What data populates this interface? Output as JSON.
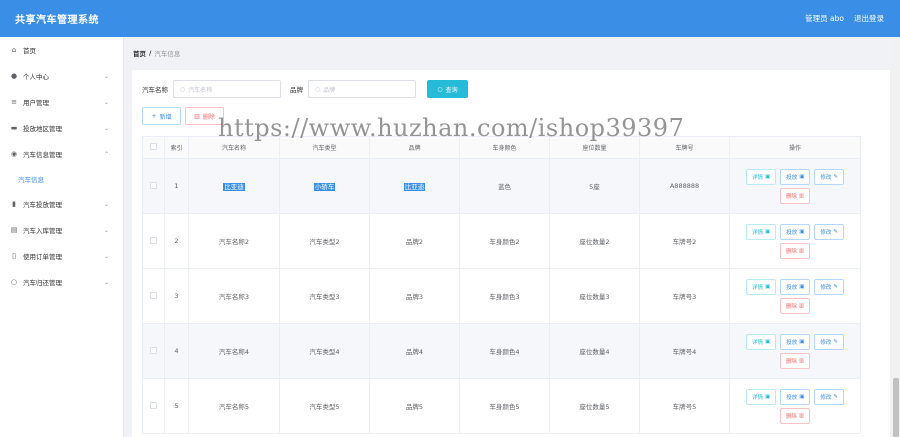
{
  "app": {
    "title": "共享汽车管理系统",
    "user": "管理员 abo",
    "logout": "退出登录"
  },
  "sidebar": {
    "items": [
      {
        "label": "首页",
        "icon": "home-icon",
        "expandable": false
      },
      {
        "label": "个人中心",
        "icon": "user-icon",
        "expandable": true
      },
      {
        "label": "用户管理",
        "icon": "list-icon",
        "expandable": true
      },
      {
        "label": "投放地区管理",
        "icon": "monitor-icon",
        "expandable": true
      },
      {
        "label": "汽车信息管理",
        "icon": "location-icon",
        "expandable": true,
        "expanded": true
      },
      {
        "label": "汽车投放管理",
        "icon": "bar-chart-icon",
        "expandable": true
      },
      {
        "label": "汽车入库管理",
        "icon": "box-icon",
        "expandable": true
      },
      {
        "label": "使用订单管理",
        "icon": "phone-icon",
        "expandable": true
      },
      {
        "label": "汽车归还管理",
        "icon": "circle-icon",
        "expandable": true
      }
    ],
    "sub_item": "汽车信息"
  },
  "breadcrumb": {
    "home": "首页",
    "separator": "/",
    "current": "汽车信息"
  },
  "search": {
    "name_label": "汽车名称",
    "name_placeholder": "汽车名称",
    "brand_label": "品牌",
    "brand_placeholder": "品牌",
    "query_button": "查询"
  },
  "actions": {
    "add": "新增",
    "delete": "删除"
  },
  "table": {
    "headers": [
      "索引",
      "汽车名称",
      "汽车类型",
      "品牌",
      "车身颜色",
      "座位数量",
      "车牌号",
      "操作"
    ],
    "rows": [
      {
        "index": "1",
        "name": "比亚迪",
        "type": "小轿车",
        "brand": "比亚迪",
        "color": "蓝色",
        "seats": "5座",
        "plate": "A888888"
      },
      {
        "index": "2",
        "name": "汽车名称2",
        "type": "汽车类型2",
        "brand": "品牌2",
        "color": "车身颜色2",
        "seats": "座位数量2",
        "plate": "车牌号2"
      },
      {
        "index": "3",
        "name": "汽车名称3",
        "type": "汽车类型3",
        "brand": "品牌3",
        "color": "车身颜色3",
        "seats": "座位数量3",
        "plate": "车牌号3"
      },
      {
        "index": "4",
        "name": "汽车名称4",
        "type": "汽车类型4",
        "brand": "品牌4",
        "color": "车身颜色4",
        "seats": "座位数量4",
        "plate": "车牌号4"
      },
      {
        "index": "5",
        "name": "汽车名称5",
        "type": "汽车类型5",
        "brand": "品牌5",
        "color": "车身颜色5",
        "seats": "座位数量5",
        "plate": "车牌号5"
      }
    ],
    "row_ops": {
      "detail": "详情",
      "report": "投放",
      "edit": "修改",
      "delete": "删除"
    }
  },
  "watermark": "https://www.huzhan.com/ishop39397",
  "colors": {
    "header": "#3a8ee6",
    "query_button": "#26bcd7",
    "danger": "#f56c6c"
  }
}
